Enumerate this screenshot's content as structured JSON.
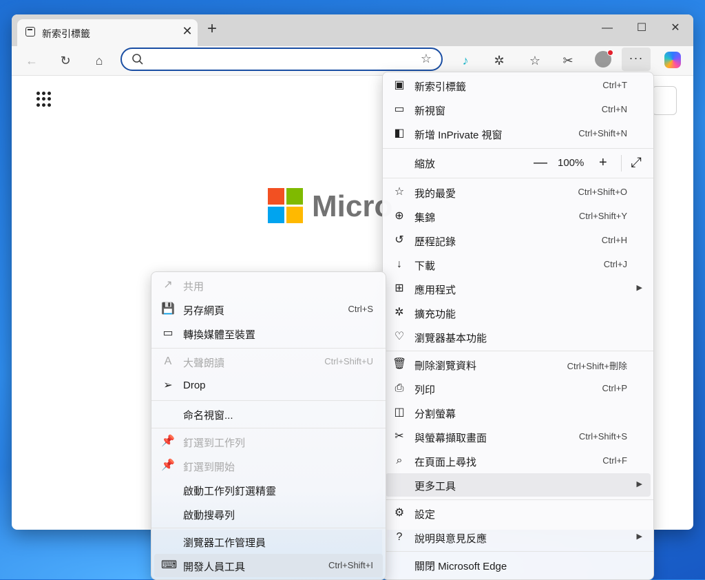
{
  "window": {
    "tab_title": "新索引標籤",
    "tab_close": "✕",
    "new_tab": "+",
    "minimize": "—",
    "maximize": "☐",
    "close": "✕"
  },
  "toolbar": {
    "back": "←",
    "refresh": "↻",
    "home": "⌂",
    "more": "···"
  },
  "page": {
    "logo_text": "Micro",
    "logo_colors": [
      "#f25022",
      "#7fba00",
      "#00a4ef",
      "#ffb900"
    ]
  },
  "main_menu": {
    "new_tab": {
      "label": "新索引標籤",
      "shortcut": "Ctrl+T"
    },
    "new_window": {
      "label": "新視窗",
      "shortcut": "Ctrl+N"
    },
    "new_inprivate": {
      "label": "新增 InPrivate 視窗",
      "shortcut": "Ctrl+Shift+N"
    },
    "zoom": {
      "label": "縮放",
      "minus": "—",
      "value": "100%",
      "plus": "+",
      "fullscreen": "⤢"
    },
    "favorites": {
      "label": "我的最愛",
      "shortcut": "Ctrl+Shift+O"
    },
    "collections": {
      "label": "集錦",
      "shortcut": "Ctrl+Shift+Y"
    },
    "history": {
      "label": "歷程記錄",
      "shortcut": "Ctrl+H"
    },
    "downloads": {
      "label": "下載",
      "shortcut": "Ctrl+J"
    },
    "apps": {
      "label": "應用程式",
      "arrow": "▶"
    },
    "extensions": {
      "label": "擴充功能"
    },
    "browser_essentials": {
      "label": "瀏覽器基本功能"
    },
    "clear_data": {
      "label": "刪除瀏覽資料",
      "shortcut": "Ctrl+Shift+刪除"
    },
    "print": {
      "label": "列印",
      "shortcut": "Ctrl+P"
    },
    "split_screen": {
      "label": "分割螢幕"
    },
    "screenshot": {
      "label": "與螢幕擷取畫面",
      "shortcut": "Ctrl+Shift+S"
    },
    "find": {
      "label": "在頁面上尋找",
      "shortcut": "Ctrl+F"
    },
    "more_tools": {
      "label": "更多工具",
      "arrow": "▶"
    },
    "settings": {
      "label": "設定"
    },
    "help": {
      "label": "說明與意見反應",
      "arrow": "▶"
    },
    "close_edge": {
      "label": "關閉 Microsoft Edge"
    }
  },
  "sub_menu": {
    "share": {
      "label": "共用"
    },
    "save_page": {
      "label": "另存網頁",
      "shortcut": "Ctrl+S"
    },
    "cast": {
      "label": "轉換媒體至裝置"
    },
    "read_aloud": {
      "label": "大聲朗讀",
      "shortcut": "Ctrl+Shift+U"
    },
    "drop": {
      "label": "Drop"
    },
    "name_window": {
      "label": "命名視窗..."
    },
    "pin_taskbar": {
      "label": "釘選到工作列"
    },
    "pin_start": {
      "label": "釘選到開始"
    },
    "taskbar_wizard": {
      "label": "啟動工作列釘選精靈"
    },
    "search_bar": {
      "label": "啟動搜尋列"
    },
    "task_manager": {
      "label": "瀏覽器工作管理員"
    },
    "dev_tools": {
      "label": "開發人員工具",
      "shortcut": "Ctrl+Shift+I"
    }
  }
}
